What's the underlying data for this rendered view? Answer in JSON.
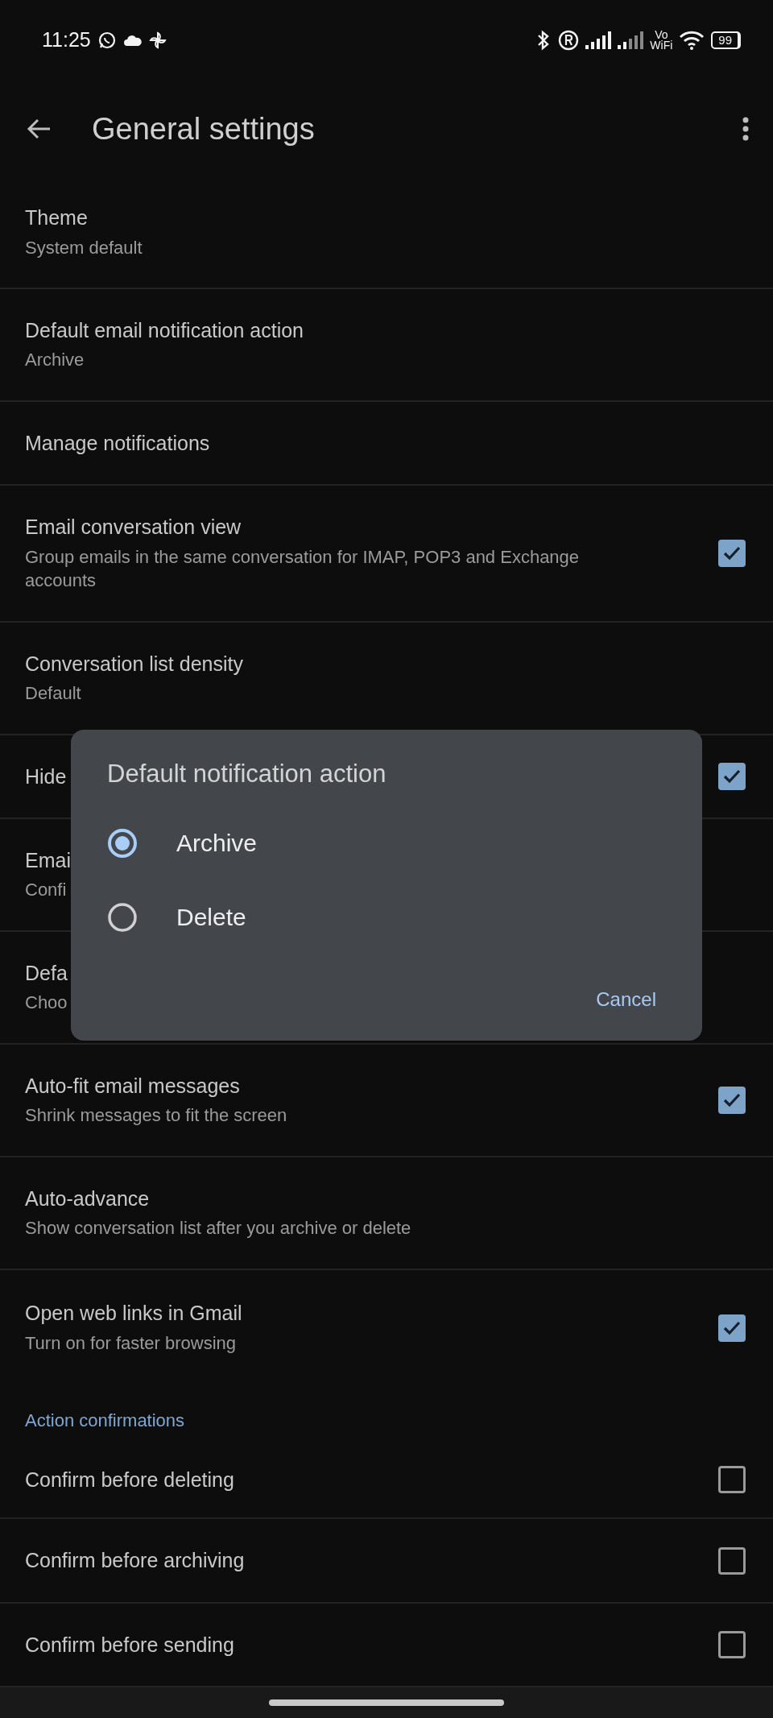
{
  "status_bar": {
    "time": "11:25",
    "vowifi_top": "Vo",
    "vowifi_bottom": "WiFi",
    "battery": "99"
  },
  "app_bar": {
    "title": "General settings"
  },
  "settings": [
    {
      "kind": "text",
      "title": "Theme",
      "subtitle": "System default"
    },
    {
      "kind": "text",
      "title": "Default email notification action",
      "subtitle": "Archive"
    },
    {
      "kind": "text",
      "title": "Manage notifications"
    },
    {
      "kind": "checkbox",
      "title": "Email conversation view",
      "subtitle": "Group emails in the same conversation for IMAP, POP3 and Exchange accounts",
      "checked": true
    },
    {
      "kind": "text",
      "title": "Conversation list density",
      "subtitle": "Default"
    },
    {
      "kind": "checkbox",
      "title": "Hide",
      "checked": true
    },
    {
      "kind": "text",
      "title": "Emai",
      "subtitle": "Confi"
    },
    {
      "kind": "text",
      "title": "Defa",
      "subtitle": "Choo"
    },
    {
      "kind": "checkbox",
      "title": "Auto-fit email messages",
      "subtitle": "Shrink messages to fit the screen",
      "checked": true
    },
    {
      "kind": "text",
      "title": "Auto-advance",
      "subtitle": "Show conversation list after you archive or delete"
    },
    {
      "kind": "checkbox",
      "title": "Open web links in Gmail",
      "subtitle": "Turn on for faster browsing",
      "checked": true
    },
    {
      "kind": "header",
      "title": "Action confirmations"
    },
    {
      "kind": "checkbox",
      "title": "Confirm before deleting",
      "checked": false
    },
    {
      "kind": "checkbox",
      "title": "Confirm before archiving",
      "checked": false
    },
    {
      "kind": "checkbox",
      "title": "Confirm before sending",
      "checked": false
    }
  ],
  "dialog": {
    "title": "Default notification action",
    "options": [
      {
        "label": "Archive",
        "selected": true
      },
      {
        "label": "Delete",
        "selected": false
      }
    ],
    "cancel": "Cancel"
  }
}
